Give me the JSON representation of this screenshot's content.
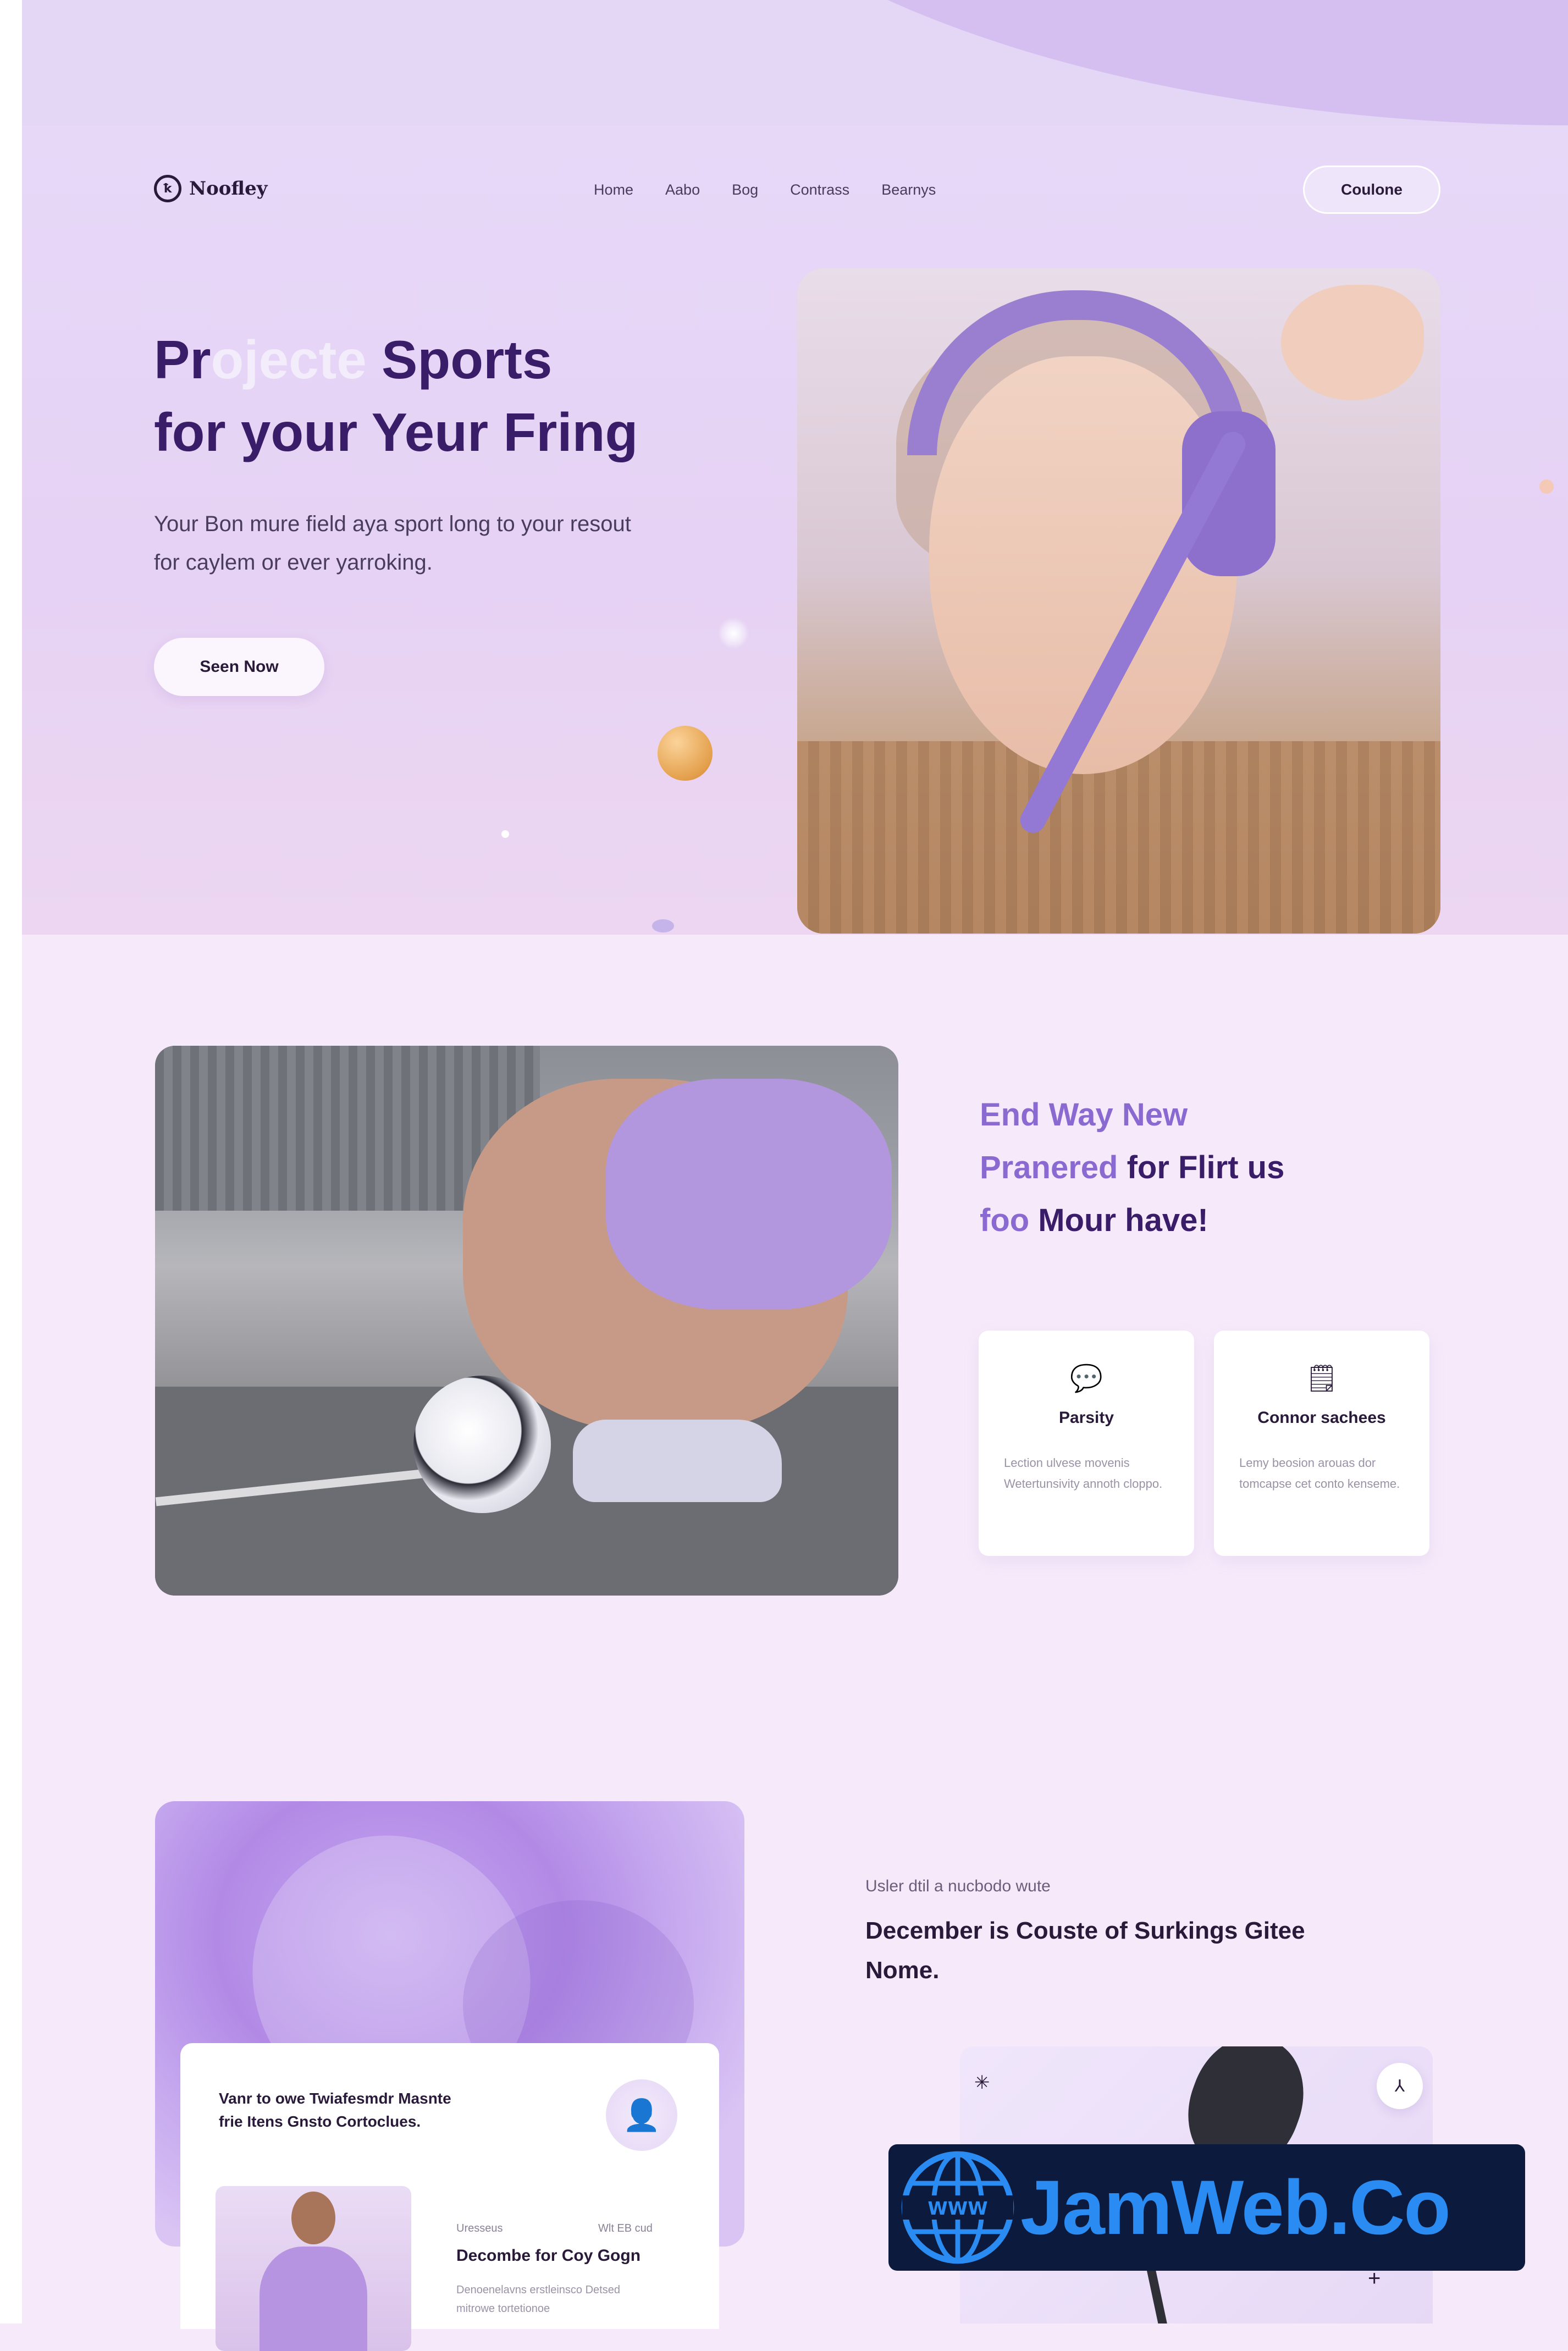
{
  "brand": {
    "name": "Noofley"
  },
  "nav": {
    "items": [
      "Home",
      "Aabo",
      "Bog",
      "Contrass",
      "Bearnys"
    ]
  },
  "header_cta": {
    "label": "Coulone"
  },
  "hero": {
    "title_line1_a": "Pr",
    "title_line1_ghost": "ojecte",
    "title_line1_b": " Sports",
    "title_line2": "for your Yeur Fring",
    "subtitle": "Your Bon mure field aya sport long to your resout for caylem or ever yarroking.",
    "button": "Seen Now"
  },
  "section2": {
    "title_line1": "End Way New",
    "title_line2_a": "Pranered ",
    "title_line2_b": "for Flirt us",
    "title_line3_a": "foo ",
    "title_line3_b": "Mour have!",
    "features": [
      {
        "icon": "speech-bubble-icon",
        "glyph": "💬",
        "title": "Parsity",
        "desc": "Lection ulvese movenis Wetertunsivity annoth cloppo."
      },
      {
        "icon": "document-icon",
        "glyph": "🗒",
        "title": "Connor sachees",
        "desc": "Lemy beosion arouas dor tomcapse cet conto kenseme."
      }
    ]
  },
  "section3": {
    "card_title": "Vanr to owe Twiafesmdr Masnte frie Itens Gnsto Cortoclues.",
    "card_meta_left": "Uresseus",
    "card_meta_right": "Wlt EB cud",
    "card_subtitle": "Decombe for Coy Gogn",
    "card_desc": "Denoenelavns erstleinsco Detsed mitrowe tortetionoe",
    "eyebrow": "Usler dtil a nucbodo wute",
    "title": "December is Couste of Surkings Gitee Nome."
  },
  "watermark": {
    "text": "JamWeb.Co",
    "globe_label": "WWW"
  },
  "colors": {
    "accent": "#8a6ad0",
    "primary_text": "#3a1d68",
    "hero_bg": "#e7d8f8",
    "watermark_bg": "#0c1a3e",
    "watermark_text": "#2a8cf2"
  }
}
